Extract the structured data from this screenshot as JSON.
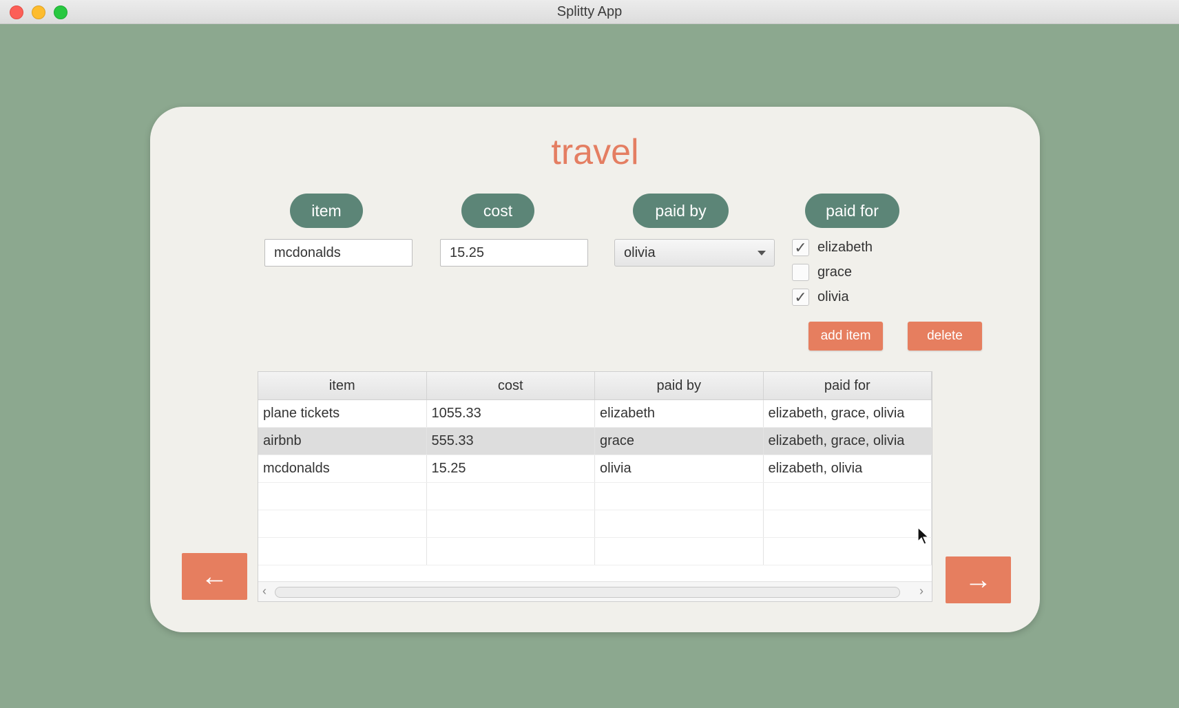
{
  "window": {
    "title": "Splitty App"
  },
  "page": {
    "title": "travel"
  },
  "form": {
    "labels": {
      "item": "item",
      "cost": "cost",
      "paid_by": "paid by",
      "paid_for": "paid for"
    },
    "item_value": "mcdonalds",
    "cost_value": "15.25",
    "paid_by_selected": "olivia",
    "paid_for_options": [
      {
        "name": "elizabeth",
        "checked": true
      },
      {
        "name": "grace",
        "checked": false
      },
      {
        "name": "olivia",
        "checked": true
      }
    ],
    "check_mark": "✓"
  },
  "actions": {
    "add_item": "add item",
    "delete": "delete"
  },
  "table": {
    "headers": [
      "item",
      "cost",
      "paid by",
      "paid for"
    ],
    "rows": [
      [
        "plane tickets",
        "1055.33",
        "elizabeth",
        "elizabeth, grace, olivia"
      ],
      [
        "airbnb",
        "555.33",
        "grace",
        "elizabeth, grace, olivia"
      ],
      [
        "mcdonalds",
        "15.25",
        "olivia",
        "elizabeth, olivia"
      ]
    ],
    "selected_row": 1,
    "scroll_left": "‹",
    "scroll_right": "›"
  },
  "nav": {
    "back": "←",
    "forward": "→"
  },
  "colors": {
    "background": "#8ca88f",
    "card": "#f1f0eb",
    "accent": "#e67e5f",
    "pill": "#5c8577",
    "title": "#e47e62"
  },
  "icons": {
    "dropdown": "chevron-down-icon",
    "cursor": "mouse-pointer-icon"
  }
}
